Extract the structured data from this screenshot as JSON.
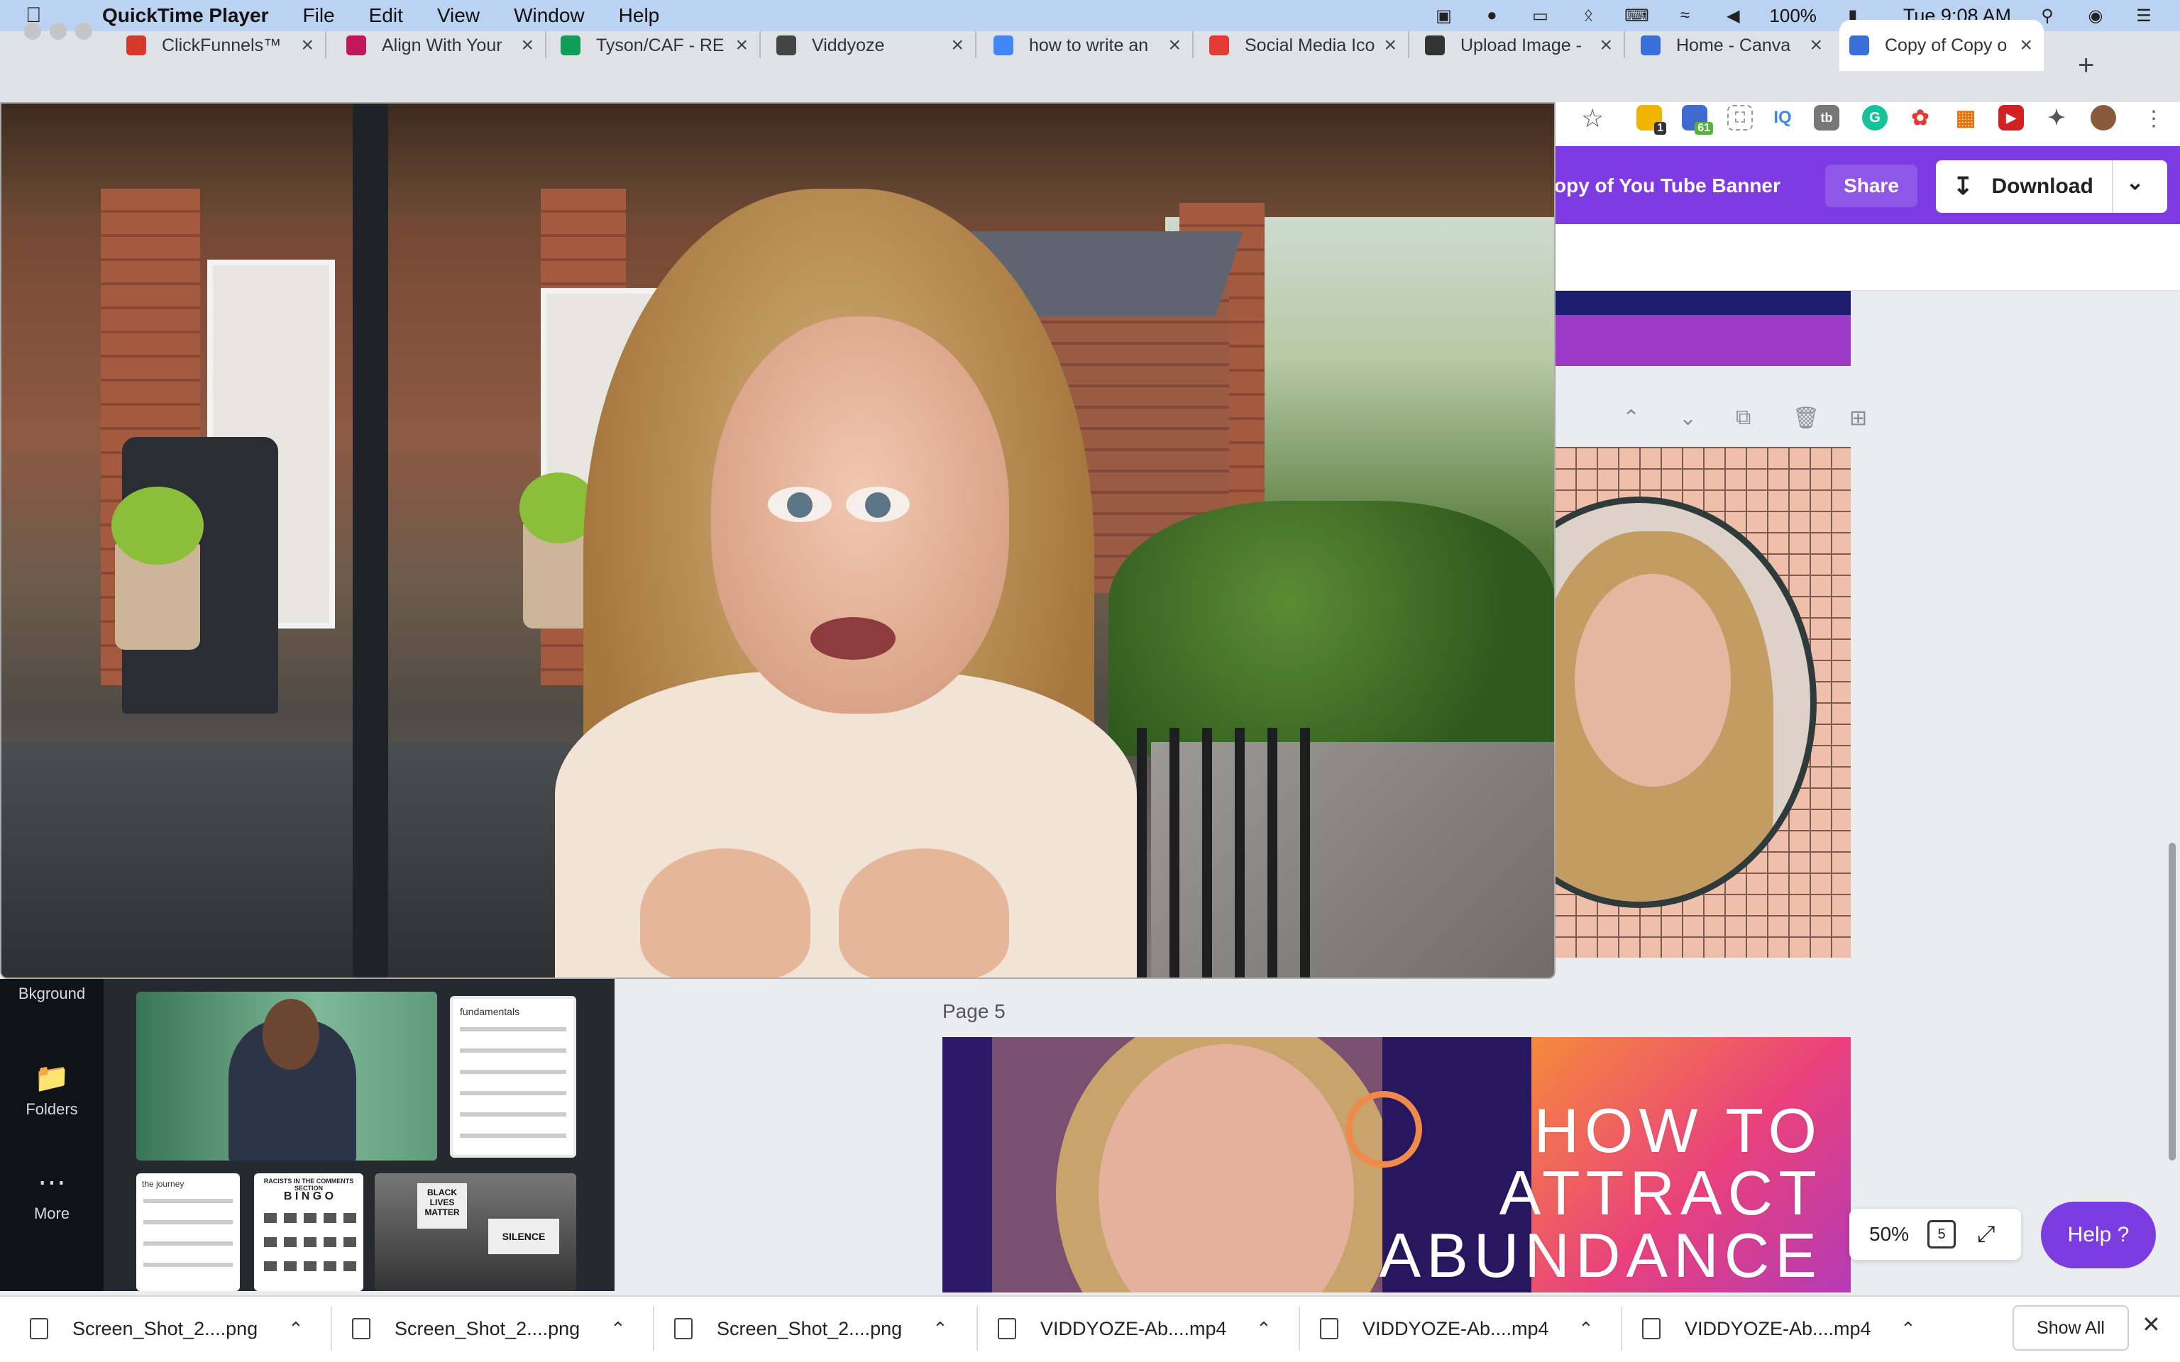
{
  "menubar": {
    "app_name": "QuickTime Player",
    "menus": [
      "File",
      "Edit",
      "View",
      "Window",
      "Help"
    ],
    "battery": "100%",
    "clock": "Tue 9:08 AM"
  },
  "tabs": [
    {
      "title": "ClickFunnels™",
      "color": "#d33a2c"
    },
    {
      "title": "Align With Your",
      "color": "#c2185b"
    },
    {
      "title": "Tyson/CAF - RE",
      "color": "#0f9d58"
    },
    {
      "title": "Viddyoze",
      "color": "#444444"
    },
    {
      "title": "how to write an",
      "color": "#4285f4"
    },
    {
      "title": "Social Media Ico",
      "color": "#e53935"
    },
    {
      "title": "Upload Image -",
      "color": "#333333"
    },
    {
      "title": "Home - Canva",
      "color": "#3b6fd8"
    },
    {
      "title": "Copy of Copy o",
      "color": "#3b6fd8"
    }
  ],
  "toolbar": {
    "ext_badge_1": "1",
    "ext_badge_2": "61",
    "ext_iq": "IQ",
    "ext_tb": "tb"
  },
  "canva": {
    "design_title": "opy of You Tube Banner",
    "share_label": "Share",
    "download_label": "Download",
    "page5_label": "Page 5",
    "page5_text": [
      "HOW TO",
      "ATTRACT",
      "ABUNDANCE"
    ],
    "zoom": "50%",
    "page_count": "5",
    "help_label": "Help  ?",
    "nav": [
      {
        "label": "Bkground"
      },
      {
        "label": "Folders"
      },
      {
        "label": "More"
      }
    ],
    "thumb_texts": {
      "th2_heading": "fundamentals",
      "th3_heading": "the journey",
      "th4_heading": "RACISTS IN THE COMMENTS SECTION",
      "th4_bingo": "B I N G O",
      "th5_sign1": "BLACK LIVES MATTER",
      "th5_sign2": "SILENCE"
    },
    "colors": {
      "header": "#7e3ae3",
      "help": "#7b3de0"
    }
  },
  "downloads": {
    "items": [
      {
        "name": "Screen_Shot_2....png"
      },
      {
        "name": "Screen_Shot_2....png"
      },
      {
        "name": "Screen_Shot_2....png"
      },
      {
        "name": "VIDDYOZE-Ab....mp4"
      },
      {
        "name": "VIDDYOZE-Ab....mp4"
      },
      {
        "name": "VIDDYOZE-Ab....mp4"
      }
    ],
    "show_all": "Show All"
  }
}
